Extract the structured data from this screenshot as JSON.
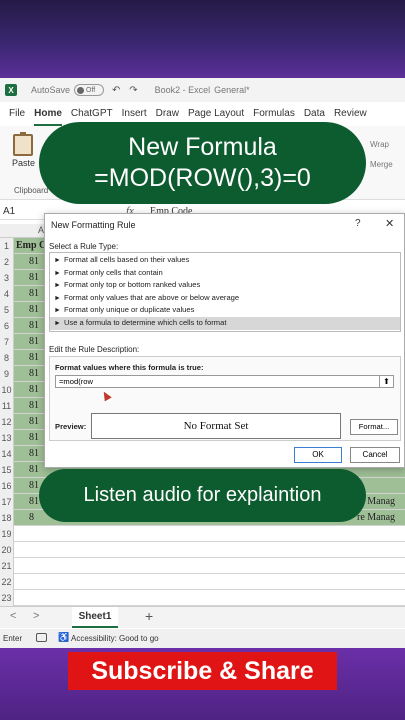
{
  "titlebar": {
    "app_icon_letter": "X",
    "autosave_label": "AutoSave",
    "autosave_state": "Off",
    "quick_access": "↶ ↷",
    "doc_title": "Book2 - Excel",
    "sensitivity": "General*"
  },
  "menu": {
    "tabs": [
      "File",
      "Home",
      "ChatGPT",
      "Insert",
      "Draw",
      "Page Layout",
      "Formulas",
      "Data",
      "Review"
    ],
    "active": "Home"
  },
  "ribbon": {
    "paste_label": "Paste",
    "clipboard_group": "Clipboard",
    "wrap_label": "Wrap",
    "merge_label": "Merge"
  },
  "formula_bar": {
    "namebox": "A1",
    "fx": "fx",
    "content": "Emp Code"
  },
  "grid": {
    "col_heads": [
      "A"
    ],
    "row_numbers": [
      "1",
      "2",
      "3",
      "4",
      "5",
      "6",
      "7",
      "8",
      "9",
      "10",
      "11",
      "12",
      "13",
      "14",
      "15",
      "16",
      "17",
      "18",
      "19",
      "20",
      "21",
      "22",
      "23"
    ],
    "col_a": [
      "Emp C",
      "81",
      "81",
      "81",
      "81",
      "81",
      "81",
      "81",
      "81",
      "81",
      "81",
      "81",
      "81",
      "81",
      "81",
      "81",
      "81",
      "8",
      "",
      "",
      "",
      "",
      ""
    ],
    "right_col": [
      "",
      "",
      "",
      "",
      "",
      "",
      "",
      "",
      "",
      "",
      "",
      "",
      "",
      "",
      "",
      "",
      "re Manag",
      "re Manag",
      "",
      "",
      "",
      "",
      ""
    ]
  },
  "sheets": {
    "prev": "<",
    "next": ">",
    "active_tab": "Sheet1",
    "add": "+"
  },
  "status": {
    "mode": "Enter",
    "accessibility_icon": "♿",
    "accessibility": "Accessibility: Good to go"
  },
  "dialog": {
    "title": "New Formatting Rule",
    "help": "?",
    "close": "✕",
    "select_rule_type": "Select a Rule Type:",
    "rule_types": [
      "Format all cells based on their values",
      "Format only cells that contain",
      "Format only top or bottom ranked values",
      "Format only values that are above or below average",
      "Format only unique or duplicate values",
      "Use a formula to determine which cells to format"
    ],
    "selected_rule_index": 5,
    "edit_description": "Edit the Rule Description:",
    "formula_label": "Format values where this formula is true:",
    "formula_value": "=mod(row",
    "preview_label": "Preview:",
    "preview_text": "No Format Set",
    "format_button": "Format...",
    "ok_button": "OK",
    "cancel_button": "Cancel"
  },
  "overlay": {
    "top_line1": "New Formula",
    "top_line2": "=MOD(ROW(),3)=0",
    "bottom": "Listen audio for explaintion",
    "subscribe": "Subscribe & Share"
  },
  "colors": {
    "pill_green": "#0d5c2f",
    "highlight_green": "#9fbf96",
    "subscribe_red": "#e01414",
    "band_purple": "#5b2f98"
  }
}
